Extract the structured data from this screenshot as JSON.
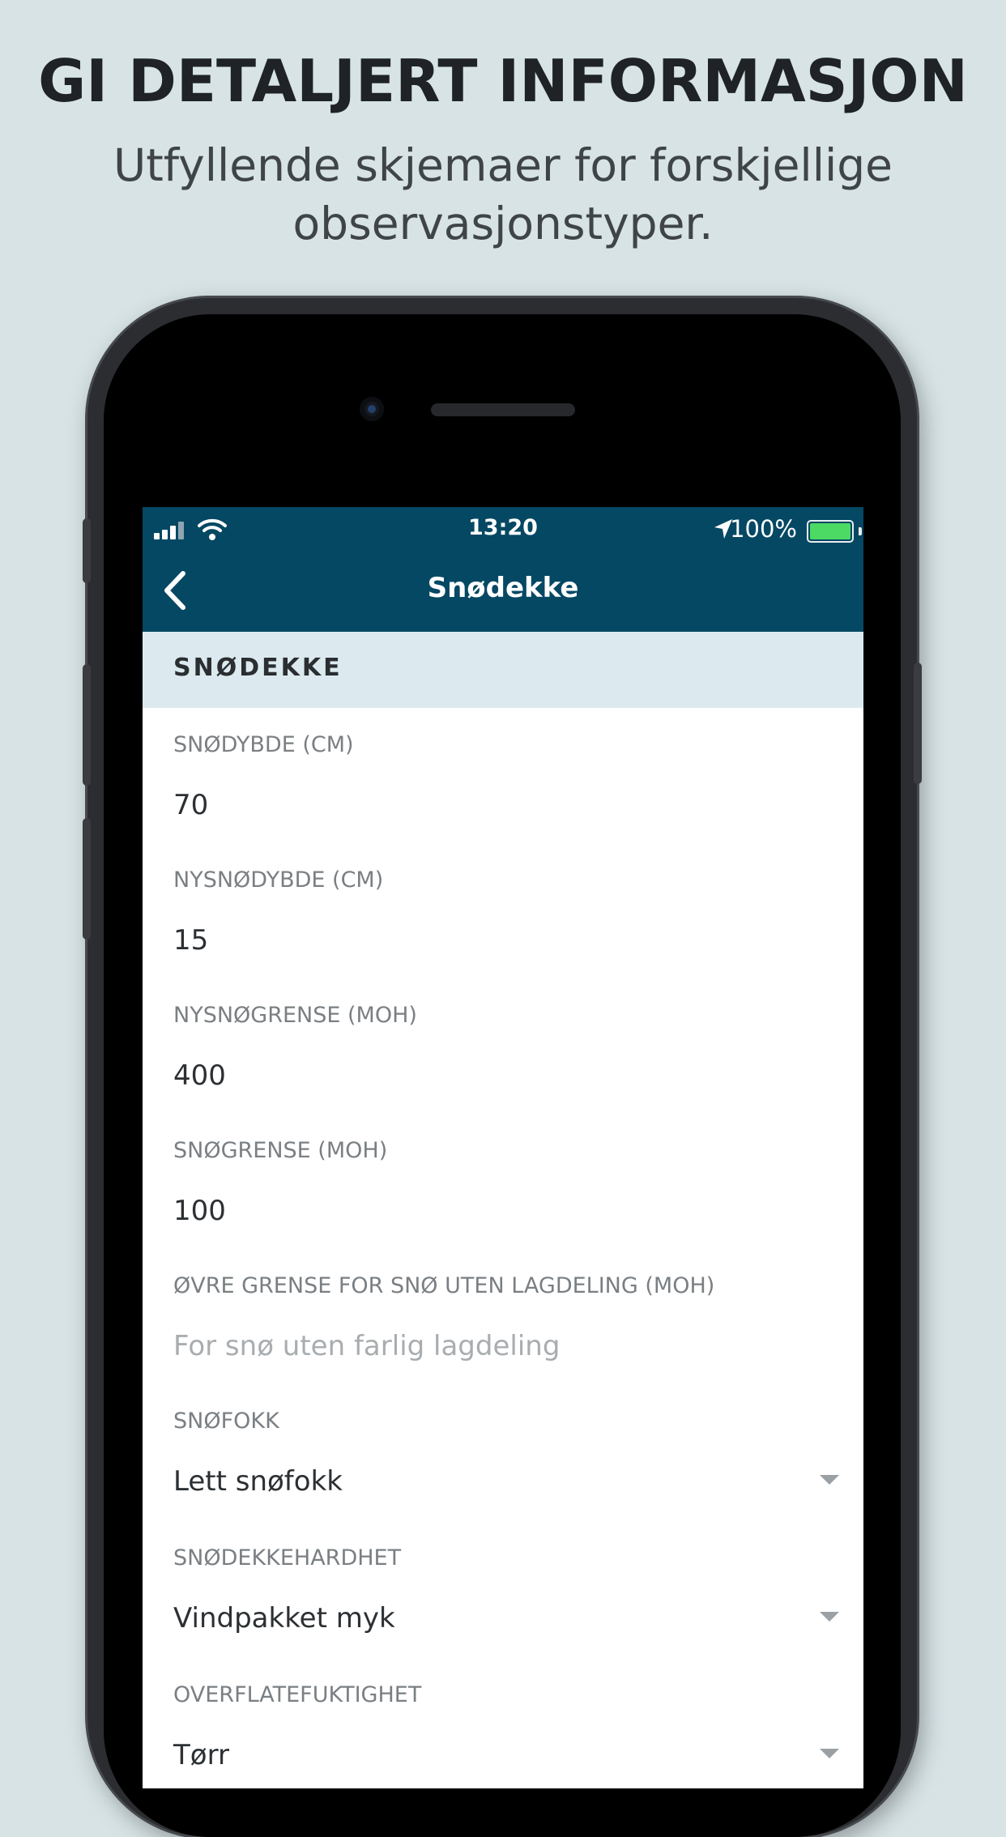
{
  "promo": {
    "headline": "GI DETALJERT INFORMASJON",
    "subline": "Utfyllende skjemaer for forskjellige observasjonstyper."
  },
  "statusbar": {
    "time": "13:20",
    "battery": "100%"
  },
  "navbar": {
    "title": "Snødekke"
  },
  "section": {
    "title": "SNØDEKKE"
  },
  "fields": [
    {
      "label": "SNØDYBDE (CM)",
      "value": "70"
    },
    {
      "label": "NYSNØDYBDE (CM)",
      "value": "15"
    },
    {
      "label": "NYSNØGRENSE (MOH)",
      "value": "400"
    },
    {
      "label": "SNØGRENSE (MOH)",
      "value": "100"
    },
    {
      "label": "ØVRE GRENSE FOR SNØ UTEN LAGDELING (MOH)",
      "placeholder": "For snø uten farlig lagdeling"
    },
    {
      "label": "SNØFOKK",
      "value": "Lett snøfokk"
    },
    {
      "label": "SNØDEKKEHARDHET",
      "value": "Vindpakket myk"
    },
    {
      "label": "OVERFLATEFUKTIGHET",
      "value": "Tørr"
    }
  ],
  "colors": {
    "background": "#d7e3e5",
    "navbar": "#054863",
    "section": "#dceaf0",
    "battery": "#4cd964"
  },
  "icons": [
    "signal-icon",
    "wifi-icon",
    "location-arrow-icon",
    "battery-icon",
    "back-chevron-icon",
    "dropdown-caret-icon"
  ]
}
